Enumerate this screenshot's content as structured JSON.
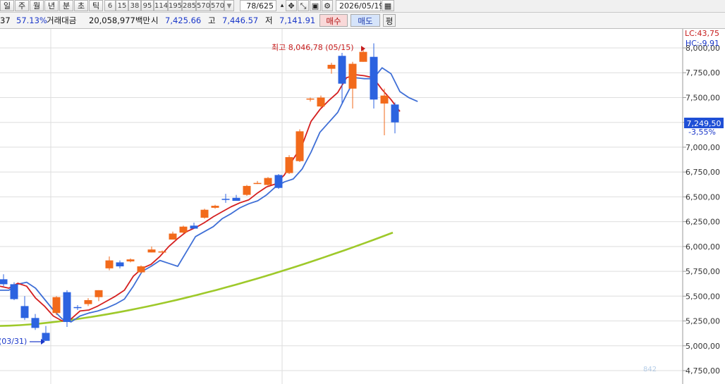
{
  "toolbar": {
    "period_buttons": [
      "일",
      "주",
      "월",
      "년",
      "분",
      "초",
      "틱"
    ],
    "interval_buttons": [
      "6",
      "15",
      "38",
      "95",
      "114",
      "195",
      "285",
      "570",
      "570"
    ],
    "count_display": "78/625",
    "date_display": "2026/05/19",
    "dropdown_icon": "chevron-down-icon",
    "tool_icons": [
      "arrows-icon",
      "cursor-cross-icon",
      "save-icon",
      "gear-icon",
      "calendar-icon"
    ]
  },
  "quote": {
    "truncated_value": "37",
    "change_pct": "57.13%",
    "volume_label": "거래대금",
    "volume_value": "20,058,977백만",
    "open_label": "시",
    "open_value": "7,425.66",
    "high_label": "고",
    "high_value": "7,446.57",
    "low_label": "저",
    "low_value": "7,141.91",
    "buy_label": "매수",
    "sell_label": "매도",
    "last_button": "평"
  },
  "chart_data": {
    "type": "candlestick",
    "ylim": [
      4750,
      8200
    ],
    "y_ticks": [
      "4,750,00",
      "5,000,00",
      "5,250,00",
      "5,500,00",
      "5,750,00",
      "6,000,00",
      "6,250,00",
      "6,500,00",
      "6,750,00",
      "7,000,00",
      "7,250,00",
      "7,500,00",
      "7,750,00",
      "8,000,00"
    ],
    "up_color": "#f26a1b",
    "down_color": "#2c63e0",
    "ma_colors": {
      "short": "#d41f1f",
      "mid": "#3f6fd6",
      "long": "#9ec92a"
    },
    "current_price": "7,249,50",
    "current_change": "-3,55%",
    "legend": {
      "lc": "LC:43,75",
      "hc": "HC:-9,91"
    },
    "annotations": {
      "high": "최고 8,046,78 (05/15)",
      "low": "(03/31)"
    },
    "candles": [
      {
        "o": 5670,
        "h": 5720,
        "l": 5600,
        "c": 5620
      },
      {
        "o": 5620,
        "h": 5640,
        "l": 5460,
        "c": 5470
      },
      {
        "o": 5400,
        "h": 5500,
        "l": 5260,
        "c": 5280
      },
      {
        "o": 5280,
        "h": 5320,
        "l": 5160,
        "c": 5180
      },
      {
        "o": 5130,
        "h": 5200,
        "l": 5050,
        "c": 5050
      },
      {
        "o": 5330,
        "h": 5500,
        "l": 5310,
        "c": 5490
      },
      {
        "o": 5540,
        "h": 5560,
        "l": 5190,
        "c": 5240
      },
      {
        "o": 5390,
        "h": 5410,
        "l": 5360,
        "c": 5380
      },
      {
        "o": 5420,
        "h": 5480,
        "l": 5400,
        "c": 5460
      },
      {
        "o": 5490,
        "h": 5560,
        "l": 5450,
        "c": 5560
      },
      {
        "o": 5780,
        "h": 5900,
        "l": 5760,
        "c": 5860
      },
      {
        "o": 5840,
        "h": 5860,
        "l": 5780,
        "c": 5800
      },
      {
        "o": 5850,
        "h": 5880,
        "l": 5840,
        "c": 5870
      },
      {
        "o": 5740,
        "h": 5810,
        "l": 5730,
        "c": 5800
      },
      {
        "o": 5940,
        "h": 6000,
        "l": 5940,
        "c": 5970
      },
      {
        "o": 5950,
        "h": 5960,
        "l": 5940,
        "c": 5950
      },
      {
        "o": 6070,
        "h": 6150,
        "l": 6070,
        "c": 6130
      },
      {
        "o": 6140,
        "h": 6210,
        "l": 6130,
        "c": 6200
      },
      {
        "o": 6210,
        "h": 6240,
        "l": 6180,
        "c": 6180
      },
      {
        "o": 6290,
        "h": 6380,
        "l": 6280,
        "c": 6370
      },
      {
        "o": 6390,
        "h": 6420,
        "l": 6380,
        "c": 6410
      },
      {
        "o": 6480,
        "h": 6530,
        "l": 6440,
        "c": 6470
      },
      {
        "o": 6490,
        "h": 6520,
        "l": 6460,
        "c": 6460
      },
      {
        "o": 6520,
        "h": 6620,
        "l": 6510,
        "c": 6610
      },
      {
        "o": 6640,
        "h": 6660,
        "l": 6630,
        "c": 6640
      },
      {
        "o": 6620,
        "h": 6700,
        "l": 6610,
        "c": 6690
      },
      {
        "o": 6720,
        "h": 6730,
        "l": 6580,
        "c": 6590
      },
      {
        "o": 6740,
        "h": 6920,
        "l": 6730,
        "c": 6900
      },
      {
        "o": 6860,
        "h": 7180,
        "l": 6850,
        "c": 7160
      },
      {
        "o": 7490,
        "h": 7500,
        "l": 7460,
        "c": 7490
      },
      {
        "o": 7410,
        "h": 7520,
        "l": 7400,
        "c": 7500
      },
      {
        "o": 7790,
        "h": 7850,
        "l": 7740,
        "c": 7830
      },
      {
        "o": 7920,
        "h": 7950,
        "l": 7440,
        "c": 7640
      },
      {
        "o": 7590,
        "h": 7860,
        "l": 7390,
        "c": 7840
      },
      {
        "o": 7860,
        "h": 8000,
        "l": 7860,
        "c": 7960
      },
      {
        "o": 7910,
        "h": 8046,
        "l": 7390,
        "c": 7480
      },
      {
        "o": 7440,
        "h": 7590,
        "l": 7120,
        "c": 7520
      },
      {
        "o": 7430,
        "h": 7450,
        "l": 7140,
        "c": 7250
      }
    ],
    "ma_short": [
      5600,
      5580,
      5630,
      5600,
      5480,
      5400,
      5300,
      5250,
      5270,
      5350,
      5360,
      5400,
      5450,
      5500,
      5560,
      5700,
      5780,
      5820,
      5900,
      6000,
      6080,
      6150,
      6190,
      6240,
      6300,
      6350,
      6400,
      6440,
      6470,
      6540,
      6600,
      6630,
      6720,
      6880,
      7020,
      7260,
      7380,
      7470,
      7550,
      7700,
      7730,
      7720,
      7700,
      7580,
      7480,
      7360
    ],
    "ma_mid": [
      5560,
      5560,
      5620,
      5640,
      5580,
      5470,
      5360,
      5270,
      5240,
      5300,
      5330,
      5350,
      5380,
      5420,
      5470,
      5600,
      5750,
      5800,
      5860,
      5830,
      5800,
      5950,
      6100,
      6150,
      6200,
      6280,
      6330,
      6390,
      6430,
      6460,
      6520,
      6600,
      6650,
      6680,
      6780,
      6950,
      7150,
      7250,
      7350,
      7530,
      7700,
      7690,
      7690,
      7800,
      7740,
      7560,
      7500,
      7460
    ],
    "ma_long_start": 5200,
    "ma_long_end": 6140
  },
  "footer": {
    "overlay_note": "842"
  }
}
